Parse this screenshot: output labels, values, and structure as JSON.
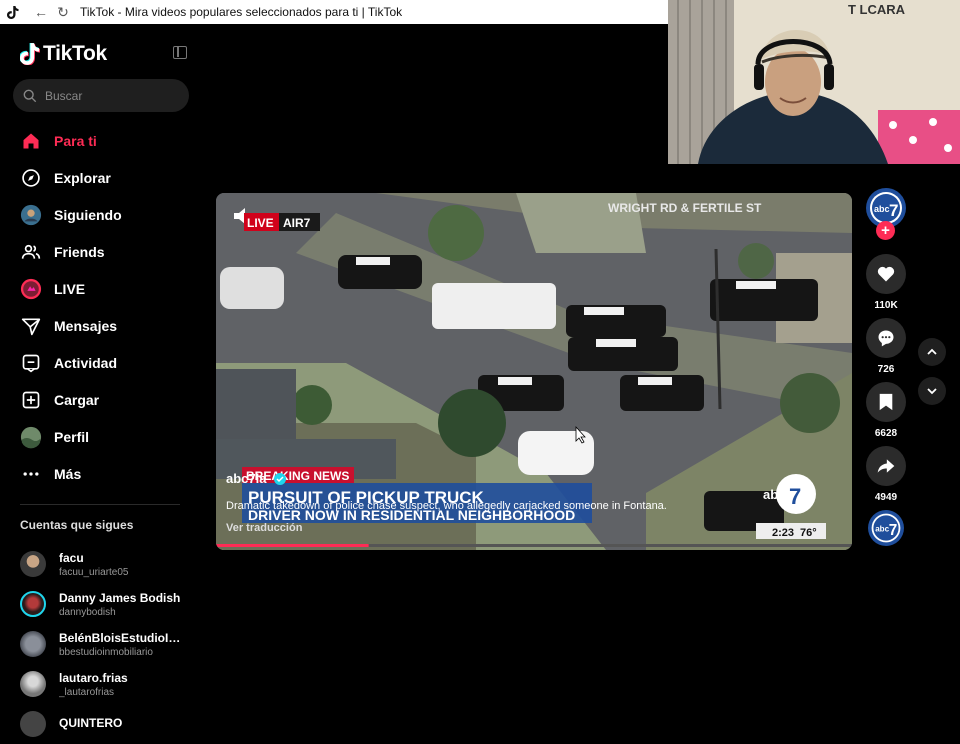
{
  "window": {
    "title": "TikTok - Mira videos populares seleccionados para ti | TikTok"
  },
  "brand": {
    "name": "TikTok"
  },
  "search": {
    "placeholder": "Buscar"
  },
  "nav": [
    {
      "label": "Para ti",
      "icon": "home-icon",
      "active": true
    },
    {
      "label": "Explorar",
      "icon": "compass-icon"
    },
    {
      "label": "Siguiendo",
      "icon": "following-avatar-icon"
    },
    {
      "label": "Friends",
      "icon": "friends-icon"
    },
    {
      "label": "LIVE",
      "icon": "live-icon"
    },
    {
      "label": "Mensajes",
      "icon": "send-icon"
    },
    {
      "label": "Actividad",
      "icon": "activity-icon"
    },
    {
      "label": "Cargar",
      "icon": "upload-icon"
    },
    {
      "label": "Perfil",
      "icon": "profile-avatar-icon"
    },
    {
      "label": "Más",
      "icon": "more-icon"
    }
  ],
  "following": {
    "title": "Cuentas que sigues",
    "accounts": [
      {
        "name": "facu",
        "handle": "facuu_uriarte05"
      },
      {
        "name": "Danny James Bodish",
        "handle": "dannybodish"
      },
      {
        "name": "BelénBloisEstudioIn...",
        "handle": "bbestudioinmobiliario"
      },
      {
        "name": "lautaro.frias",
        "handle": "_lautarofrias"
      },
      {
        "name": "QUINTERO",
        "handle": ""
      }
    ]
  },
  "webcam": {
    "wall_text": "T LCARA"
  },
  "video": {
    "overlay_location": "WRIGHT RD & FERTILE ST",
    "live_badge": "LIVE",
    "air_badge": "AIR7",
    "breaking_label": "BREAKING NEWS",
    "headline_line1": "PURSUIT OF PICKUP TRUCK",
    "headline_line2": "DRIVER NOW IN RESIDENTIAL NEIGHBORHOOD",
    "clock": "2:23",
    "temp": "76°",
    "author": "abc7la",
    "description": "Dramatic takedown of police chase suspect, who allegedly carjacked someone in Fontana.",
    "translate_link": "Ver traducción",
    "progress": 0.24
  },
  "actions": {
    "likes": "110K",
    "comments": "726",
    "saves": "6628",
    "shares": "4949"
  },
  "colors": {
    "accent": "#fe2c55",
    "verified": "#20d5ec"
  }
}
